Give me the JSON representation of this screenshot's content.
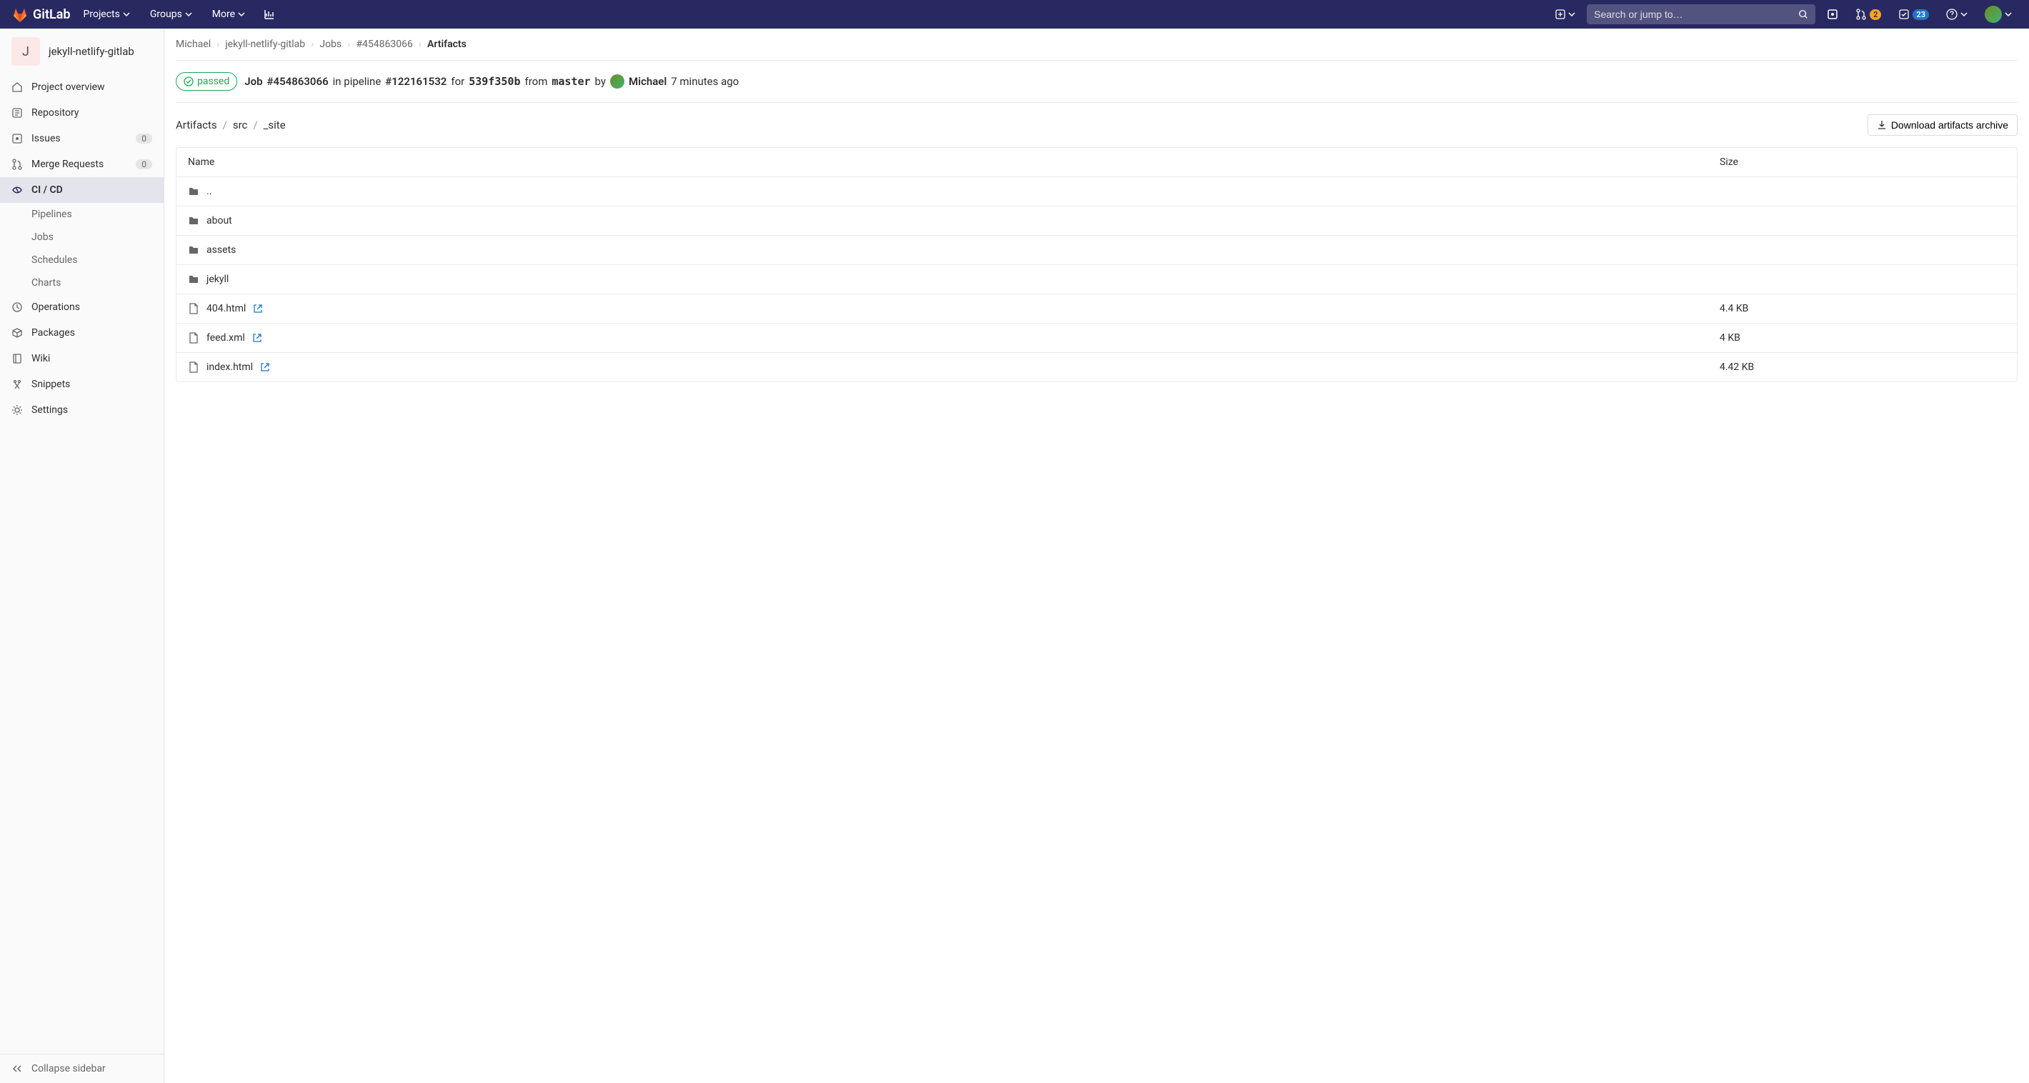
{
  "navbar": {
    "brand": "GitLab",
    "projects": "Projects",
    "groups": "Groups",
    "more": "More",
    "search_placeholder": "Search or jump to…",
    "mr_badge": "2",
    "todo_badge": "23"
  },
  "sidebar": {
    "project_letter": "J",
    "project_name": "jekyll-netlify-gitlab",
    "items": [
      {
        "label": "Project overview"
      },
      {
        "label": "Repository"
      },
      {
        "label": "Issues",
        "badge": "0"
      },
      {
        "label": "Merge Requests",
        "badge": "0"
      },
      {
        "label": "CI / CD",
        "active": true
      },
      {
        "label": "Operations"
      },
      {
        "label": "Packages"
      },
      {
        "label": "Wiki"
      },
      {
        "label": "Snippets"
      },
      {
        "label": "Settings"
      }
    ],
    "subitems": [
      {
        "label": "Pipelines"
      },
      {
        "label": "Jobs"
      },
      {
        "label": "Schedules"
      },
      {
        "label": "Charts"
      }
    ],
    "collapse": "Collapse sidebar"
  },
  "breadcrumbs": {
    "items": [
      "Michael",
      "jekyll-netlify-gitlab",
      "Jobs",
      "#454863066"
    ],
    "current": "Artifacts"
  },
  "job": {
    "status": "passed",
    "label_job": "Job",
    "job_id": "#454863066",
    "in_pipeline": "in pipeline",
    "pipeline_id": "#122161532",
    "for": "for",
    "commit": "539f350b",
    "from": "from",
    "branch": "master",
    "by": "by",
    "author": "Michael",
    "time": "7 minutes ago"
  },
  "artifacts": {
    "path": [
      "Artifacts",
      "src",
      "_site"
    ],
    "download_label": "Download artifacts archive",
    "columns": {
      "name": "Name",
      "size": "Size"
    },
    "rows": [
      {
        "type": "folder",
        "name": ".."
      },
      {
        "type": "folder",
        "name": "about"
      },
      {
        "type": "folder",
        "name": "assets"
      },
      {
        "type": "folder",
        "name": "jekyll"
      },
      {
        "type": "file",
        "name": "404.html",
        "size": "4.4 KB"
      },
      {
        "type": "file",
        "name": "feed.xml",
        "size": "4 KB"
      },
      {
        "type": "file",
        "name": "index.html",
        "size": "4.42 KB"
      }
    ]
  }
}
